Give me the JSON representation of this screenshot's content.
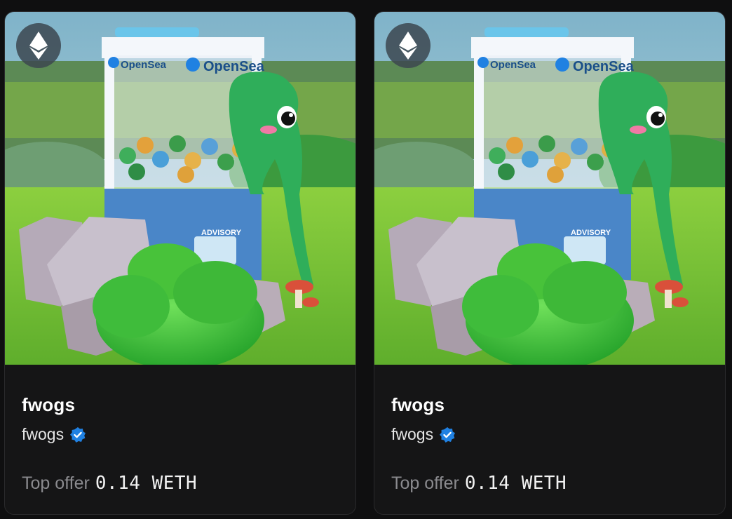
{
  "nfts": [
    {
      "title": "fwogs",
      "creator": "fwogs",
      "offer_label": "Top offer",
      "offer_value": "0.14 WETH",
      "chain_icon": "ethereum-icon",
      "verified_icon": "verified-badge-icon",
      "art": {
        "brand_text": "OpenSea",
        "sticker_text": "ADVISORY"
      }
    },
    {
      "title": "fwogs",
      "creator": "fwogs",
      "offer_label": "Top offer",
      "offer_value": "0.14 WETH",
      "chain_icon": "ethereum-icon",
      "verified_icon": "verified-badge-icon",
      "art": {
        "brand_text": "OpenSea",
        "sticker_text": "ADVISORY"
      }
    }
  ],
  "colors": {
    "card_bg": "#151516",
    "verified_blue": "#2081e2",
    "frog_green": "#2fae5a",
    "bush_green": "#3fc23a"
  }
}
